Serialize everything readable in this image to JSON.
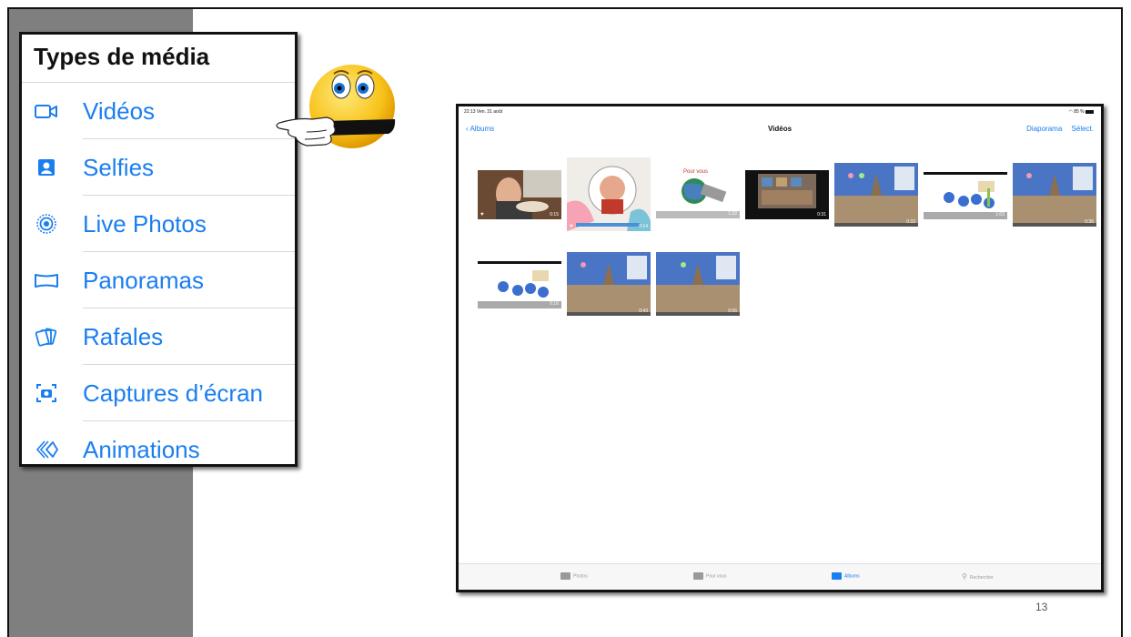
{
  "media_types": {
    "title": "Types de média",
    "items": [
      {
        "label": "Vidéos",
        "icon": "video-camera-icon"
      },
      {
        "label": "Selfies",
        "icon": "selfie-portrait-icon"
      },
      {
        "label": "Live Photos",
        "icon": "live-photo-icon"
      },
      {
        "label": "Panoramas",
        "icon": "panorama-icon"
      },
      {
        "label": "Rafales",
        "icon": "burst-icon"
      },
      {
        "label": "Captures d’écran",
        "icon": "screenshot-icon"
      },
      {
        "label": "Animations",
        "icon": "animation-icon"
      }
    ]
  },
  "ipad": {
    "status": {
      "time": "22:13  Ven. 31 août",
      "battery": "85 %"
    },
    "nav": {
      "back": "Albums",
      "title": "Vidéos",
      "slideshow": "Diaporama",
      "select": "Sélect."
    },
    "videos": [
      {
        "duration": "0:15",
        "favorite": true
      },
      {
        "duration": "0:14",
        "favorite": true
      },
      {
        "duration": "1:22",
        "favorite": false
      },
      {
        "duration": "0:31",
        "favorite": false
      },
      {
        "duration": "0:33",
        "favorite": false
      },
      {
        "duration": "1:03",
        "favorite": false
      },
      {
        "duration": "0:36",
        "favorite": false
      },
      {
        "duration": "0:16",
        "favorite": false
      },
      {
        "duration": "0:43",
        "favorite": false
      },
      {
        "duration": "0:56",
        "favorite": false
      }
    ],
    "tabs": [
      {
        "label": "Photos"
      },
      {
        "label": "Pour vous"
      },
      {
        "label": "Albums",
        "active": true
      },
      {
        "label": "Rechercher"
      }
    ]
  },
  "slide": {
    "page_number": "13"
  },
  "colors": {
    "accent": "#1a7ef0",
    "band": "#7f7f7f"
  }
}
